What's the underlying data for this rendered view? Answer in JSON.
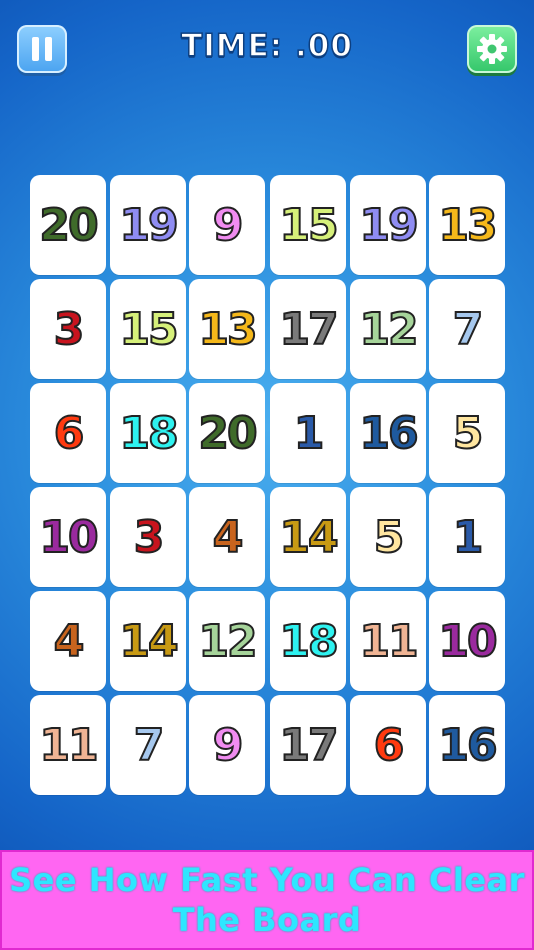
{
  "header": {
    "pause_icon": "pause-icon",
    "timer_text": "TIME: .00",
    "settings_icon": "gear-icon"
  },
  "board": {
    "rows": [
      [
        {
          "n": "20",
          "c": "#3f6b2a"
        },
        {
          "n": "19",
          "c": "#8f8cf2"
        },
        {
          "n": "9",
          "c": "#f08cf0"
        },
        {
          "n": "15",
          "c": "#d6f07a"
        },
        {
          "n": "19",
          "c": "#8f8cf2"
        },
        {
          "n": "13",
          "c": "#f5b81a"
        }
      ],
      [
        {
          "n": "3",
          "c": "#c8141e"
        },
        {
          "n": "15",
          "c": "#d6f07a"
        },
        {
          "n": "13",
          "c": "#f5b81a"
        },
        {
          "n": "17",
          "c": "#7a7a7a"
        },
        {
          "n": "12",
          "c": "#a6d49a"
        },
        {
          "n": "7",
          "c": "#a6c8ee"
        }
      ],
      [
        {
          "n": "6",
          "c": "#ff3a10"
        },
        {
          "n": "18",
          "c": "#2ef2f0"
        },
        {
          "n": "20",
          "c": "#3f6b2a"
        },
        {
          "n": "1",
          "c": "#2a5aa8"
        },
        {
          "n": "16",
          "c": "#1f5a9e"
        },
        {
          "n": "5",
          "c": "#ffe6a0"
        }
      ],
      [
        {
          "n": "10",
          "c": "#9a2a9e"
        },
        {
          "n": "3",
          "c": "#c8141e"
        },
        {
          "n": "4",
          "c": "#c8641e"
        },
        {
          "n": "14",
          "c": "#c89a14"
        },
        {
          "n": "5",
          "c": "#ffe6a0"
        },
        {
          "n": "1",
          "c": "#2a5aa8"
        }
      ],
      [
        {
          "n": "4",
          "c": "#c8641e"
        },
        {
          "n": "14",
          "c": "#c89a14"
        },
        {
          "n": "12",
          "c": "#a6d49a"
        },
        {
          "n": "18",
          "c": "#2ef2f0"
        },
        {
          "n": "11",
          "c": "#f0b494"
        },
        {
          "n": "10",
          "c": "#9a2a9e"
        }
      ],
      [
        {
          "n": "11",
          "c": "#f0b494"
        },
        {
          "n": "7",
          "c": "#a6c8ee"
        },
        {
          "n": "9",
          "c": "#f08cf0"
        },
        {
          "n": "17",
          "c": "#7a7a7a"
        },
        {
          "n": "6",
          "c": "#ff3a10"
        },
        {
          "n": "16",
          "c": "#1f5a9e"
        }
      ]
    ]
  },
  "banner": {
    "line1": "See How Fast You Can Clear",
    "line2": "The Board"
  },
  "colors": {
    "background": "#1e78d6",
    "pause_button": "#5ab0f4",
    "settings_button": "#3fd676",
    "banner_bg": "#ff66f2",
    "banner_text": "#2ee6ff"
  }
}
